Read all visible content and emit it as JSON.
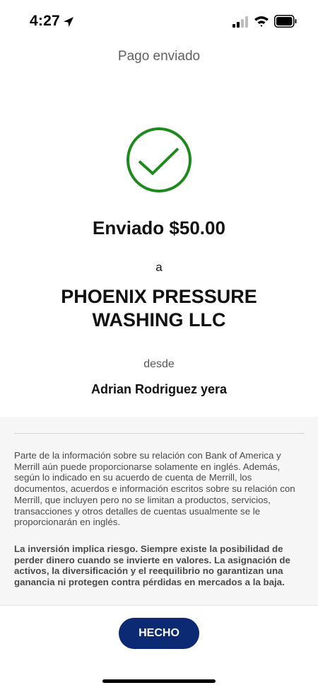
{
  "status_bar": {
    "time": "4:27",
    "icons": [
      "location-arrow-icon",
      "cellular-signal-icon",
      "wifi-icon",
      "battery-icon"
    ]
  },
  "header": {
    "title": "Pago enviado"
  },
  "confirmation": {
    "icon": "checkmark-circle-icon",
    "sent_amount": "Enviado $50.00",
    "to_label": "a",
    "recipient": "PHOENIX PRESSURE WASHING LLC",
    "from_label": "desde",
    "sender": "Adrian Rodriguez yera"
  },
  "disclosures": {
    "language_notice": "Parte de la información sobre su relación con Bank of America y Merrill aún puede proporcionarse solamente en inglés. Además, según lo indicado en su acuerdo de cuenta de Merrill, los documentos, acuerdos e información escritos sobre su relación con Merrill, que incluyen pero no se limitan a productos, servicios, transacciones y otros detalles de cuentas usualmente se le proporcionarán en inglés.",
    "risk_notice": "La inversión implica riesgo. Siempre existe la posibilidad de perder dinero cuando se invierte en valores. La asignación de activos, la diversificación y el reequilibrio no garantizan una ganancia ni protegen contra pérdidas en mercados a la baja."
  },
  "footer": {
    "done_label": "HECHO"
  },
  "colors": {
    "success_green": "#1e8a1e",
    "button_navy": "#0b2a73",
    "disclosure_background": "#f6f6f6"
  }
}
